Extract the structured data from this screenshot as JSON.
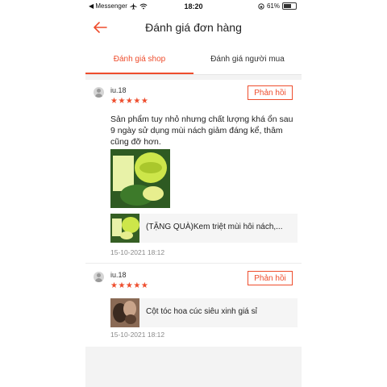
{
  "status_bar": {
    "back_app_label": "◀ Messenger",
    "time": "18:20",
    "battery_percent": "61%",
    "battery_level": 0.61
  },
  "header": {
    "title": "Đánh giá đơn hàng"
  },
  "tabs": [
    {
      "label": "Đánh giá shop",
      "active": true
    },
    {
      "label": "Đánh giá người mua",
      "active": false
    }
  ],
  "reviews": [
    {
      "username": "iu.18",
      "stars": "★★★★★",
      "rating": 5,
      "reply_label": "Phản hồi",
      "comment": "Sản phẩm tuy nhỏ nhưng chất lượng khá ổn sau 9 ngày sử dụng mùi nách giảm đáng kể, thâm cũng đỡ hơn.",
      "product_name": "(TẶNG QUÀ)Kem triệt mùi hôi nách,...",
      "date": "15-10-2021 18:12"
    },
    {
      "username": "iu.18",
      "stars": "★★★★★",
      "rating": 5,
      "reply_label": "Phản hồi",
      "product_name": "Cột tóc hoa cúc siêu xinh giá sỉ",
      "date": "15-10-2021 18:12"
    }
  ],
  "colors": {
    "accent": "#ee4d2d",
    "background": "#ffffff",
    "separator": "#f3f3f3"
  }
}
